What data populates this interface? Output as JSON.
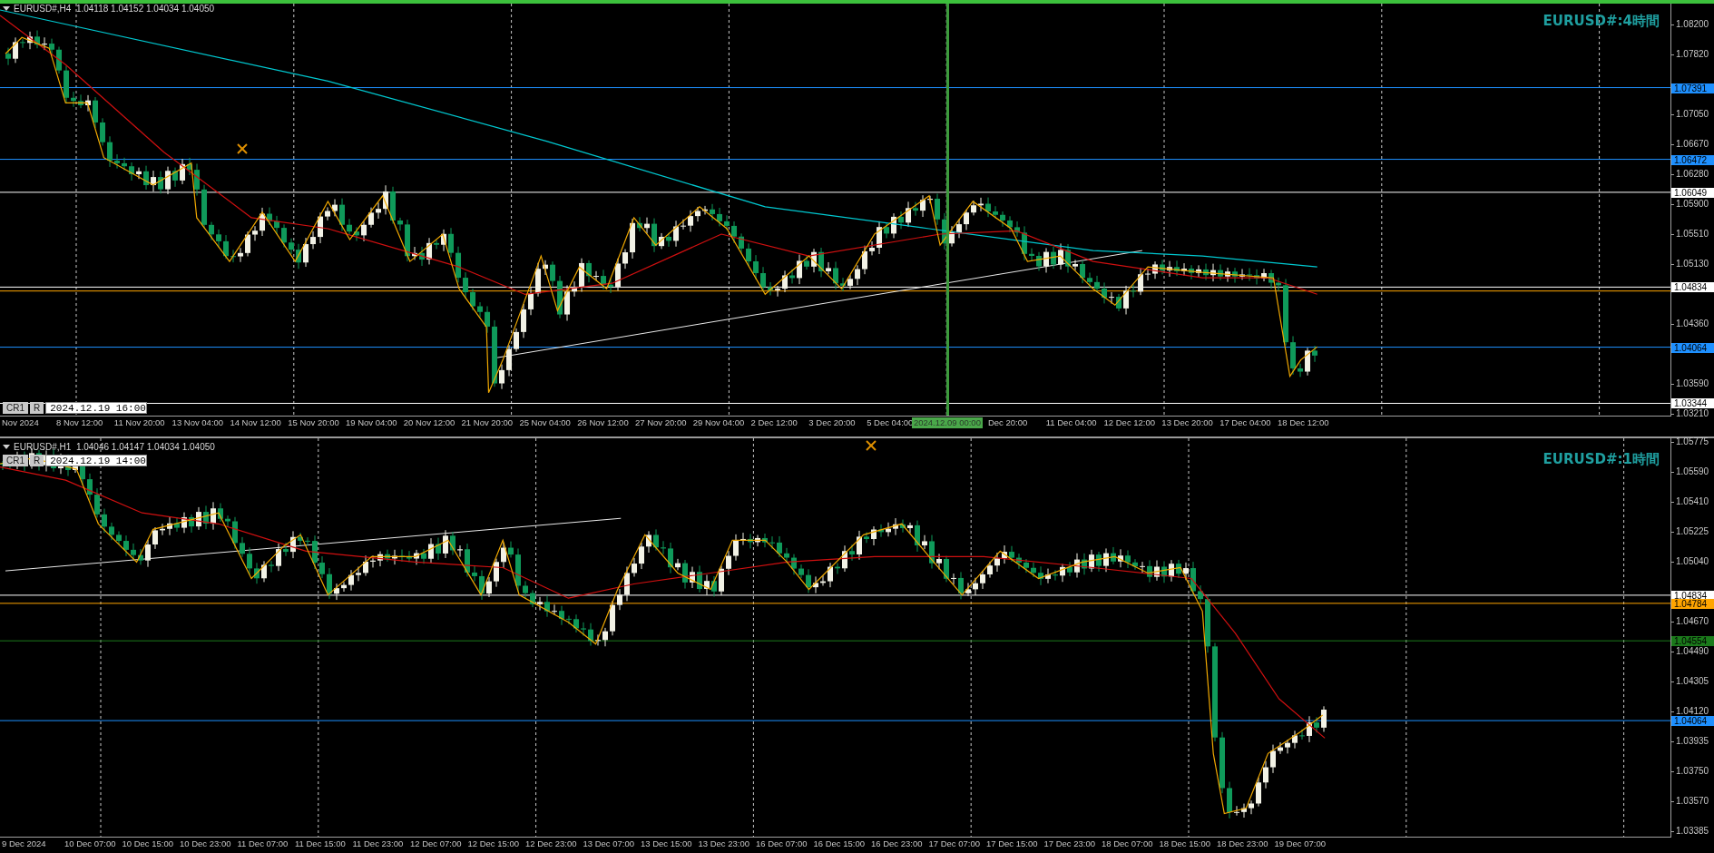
{
  "panels": [
    {
      "active": true,
      "header": "EURUSD#,H4  1.04118 1.04152 1.04034 1.04050",
      "title": "EURUSD#:4時間",
      "cr": "CR1",
      "r": "R",
      "date": "2024.12.19 16:00",
      "price_ticks": [
        "1.08200",
        "1.07820",
        "1.07050",
        "1.06670",
        "1.06280",
        "1.05900",
        "1.05510",
        "1.05130",
        "1.04360",
        "1.03590",
        "1.03210"
      ],
      "price_labels": [
        {
          "text": "1.07391",
          "color": "#1e90ff"
        },
        {
          "text": "1.06472",
          "color": "#1e90ff"
        },
        {
          "text": "1.06049",
          "color": "#ffffff"
        },
        {
          "text": "1.04834",
          "color": "#ffffff"
        },
        {
          "text": "1.04064",
          "color": "#1e90ff"
        },
        {
          "text": "1.03344",
          "color": "#ffffff"
        }
      ],
      "time_labels": [
        {
          "text": "Nov 2024",
          "kind": "tick"
        },
        {
          "text": "8 Nov 12:00",
          "kind": "tick"
        },
        {
          "text": "11 Nov 20:00",
          "kind": "tick"
        },
        {
          "text": "13 Nov 04:00",
          "kind": "tick"
        },
        {
          "text": "14 Nov 12:00",
          "kind": "tick"
        },
        {
          "text": "15 Nov 20:00",
          "kind": "tick"
        },
        {
          "text": "19 Nov 04:00",
          "kind": "tick"
        },
        {
          "text": "20 Nov 12:00",
          "kind": "tick"
        },
        {
          "text": "21 Nov 20:00",
          "kind": "tick"
        },
        {
          "text": "25 Nov 04:00",
          "kind": "tick"
        },
        {
          "text": "26 Nov 12:00",
          "kind": "tick"
        },
        {
          "text": "27 Nov 20:00",
          "kind": "tick"
        },
        {
          "text": "29 Nov 04:00",
          "kind": "tick"
        },
        {
          "text": "2 Dec 12:00",
          "kind": "tick"
        },
        {
          "text": "3 Dec 20:00",
          "kind": "tick"
        },
        {
          "text": "5 Dec 04:00",
          "kind": "tick"
        },
        {
          "text": "2024.12.09 00:00",
          "kind": "crosshair"
        },
        {
          "text": "Dec 20:00",
          "kind": "tick"
        },
        {
          "text": "11 Dec 04:00",
          "kind": "tick"
        },
        {
          "text": "12 Dec 12:00",
          "kind": "tick"
        },
        {
          "text": "13 Dec 20:00",
          "kind": "tick"
        },
        {
          "text": "17 Dec 04:00",
          "kind": "tick"
        },
        {
          "text": "18 Dec 12:00",
          "kind": "tick"
        }
      ]
    },
    {
      "active": false,
      "header": "EURUSD#,H1  1.04046 1.04147 1.04034 1.04050",
      "title": "EURUSD#:1時間",
      "cr": "CR1",
      "r": "R",
      "date": "2024.12.19 14:00",
      "price_ticks": [
        "1.05775",
        "1.05590",
        "1.05410",
        "1.05225",
        "1.05040",
        "1.04670",
        "1.04490",
        "1.04305",
        "1.04120",
        "1.03935",
        "1.03750",
        "1.03570",
        "1.03385"
      ],
      "price_labels": [
        {
          "text": "1.04834",
          "color": "#ffffff"
        },
        {
          "text": "1.04784",
          "color": "#ffa500"
        },
        {
          "text": "1.04554",
          "color": "#1b7a1b"
        },
        {
          "text": "1.04064",
          "color": "#1e90ff"
        }
      ],
      "time_labels": [
        {
          "text": "9 Dec 2024",
          "kind": "tick"
        },
        {
          "text": "10 Dec 07:00",
          "kind": "tick"
        },
        {
          "text": "10 Dec 15:00",
          "kind": "tick"
        },
        {
          "text": "10 Dec 23:00",
          "kind": "tick"
        },
        {
          "text": "11 Dec 07:00",
          "kind": "tick"
        },
        {
          "text": "11 Dec 15:00",
          "kind": "tick"
        },
        {
          "text": "11 Dec 23:00",
          "kind": "tick"
        },
        {
          "text": "12 Dec 07:00",
          "kind": "tick"
        },
        {
          "text": "12 Dec 15:00",
          "kind": "tick"
        },
        {
          "text": "12 Dec 23:00",
          "kind": "tick"
        },
        {
          "text": "13 Dec 07:00",
          "kind": "tick"
        },
        {
          "text": "13 Dec 15:00",
          "kind": "tick"
        },
        {
          "text": "13 Dec 23:00",
          "kind": "tick"
        },
        {
          "text": "16 Dec 07:00",
          "kind": "tick"
        },
        {
          "text": "16 Dec 15:00",
          "kind": "tick"
        },
        {
          "text": "16 Dec 23:00",
          "kind": "tick"
        },
        {
          "text": "17 Dec 07:00",
          "kind": "tick"
        },
        {
          "text": "17 Dec 15:00",
          "kind": "tick"
        },
        {
          "text": "17 Dec 23:00",
          "kind": "tick"
        },
        {
          "text": "18 Dec 07:00",
          "kind": "tick"
        },
        {
          "text": "18 Dec 15:00",
          "kind": "tick"
        },
        {
          "text": "18 Dec 23:00",
          "kind": "tick"
        },
        {
          "text": "19 Dec 07:00",
          "kind": "tick"
        }
      ]
    }
  ]
}
